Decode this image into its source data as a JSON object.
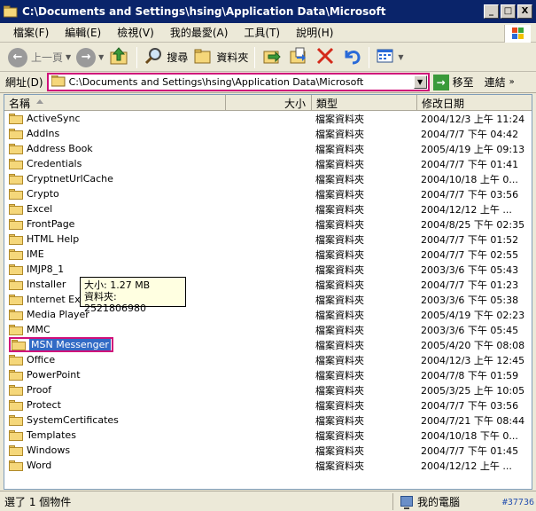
{
  "window": {
    "title": "C:\\Documents and Settings\\hsing\\Application Data\\Microsoft",
    "minimize": "_",
    "maximize": "□",
    "close": "X"
  },
  "menu": [
    "檔案(F)",
    "編輯(E)",
    "檢視(V)",
    "我的最愛(A)",
    "工具(T)",
    "說明(H)"
  ],
  "toolbar": {
    "back_label": "上一頁",
    "search_label": "搜尋",
    "folders_label": "資料夾"
  },
  "address": {
    "label": "網址(D)",
    "value": "C:\\Documents and Settings\\hsing\\Application Data\\Microsoft",
    "go_label": "移至",
    "links_label": "連結"
  },
  "columns": {
    "name": "名稱",
    "size": "大小",
    "type": "類型",
    "modified": "修改日期"
  },
  "items": [
    {
      "name": "ActiveSync",
      "type": "檔案資料夾",
      "date": "2004/12/3 上午 11:24"
    },
    {
      "name": "AddIns",
      "type": "檔案資料夾",
      "date": "2004/7/7 下午 04:42"
    },
    {
      "name": "Address Book",
      "type": "檔案資料夾",
      "date": "2005/4/19 上午 09:13"
    },
    {
      "name": "Credentials",
      "type": "檔案資料夾",
      "date": "2004/7/7 下午 01:41"
    },
    {
      "name": "CryptnetUrlCache",
      "type": "檔案資料夾",
      "date": "2004/10/18 上午 0..."
    },
    {
      "name": "Crypto",
      "type": "檔案資料夾",
      "date": "2004/7/7 下午 03:56"
    },
    {
      "name": "Excel",
      "type": "檔案資料夾",
      "date": "2004/12/12 上午 ..."
    },
    {
      "name": "FrontPage",
      "type": "檔案資料夾",
      "date": "2004/8/25 下午 02:35"
    },
    {
      "name": "HTML Help",
      "type": "檔案資料夾",
      "date": "2004/7/7 下午 01:52"
    },
    {
      "name": "IME",
      "type": "檔案資料夾",
      "date": "2004/7/7 下午 02:55"
    },
    {
      "name": "IMJP8_1",
      "type": "檔案資料夾",
      "date": "2003/3/6 下午 05:43"
    },
    {
      "name": "Installer",
      "type": "檔案資料夾",
      "date": "2004/7/7 下午 01:23"
    },
    {
      "name": "Internet Explorer",
      "type": "檔案資料夾",
      "date": "2003/3/6 下午 05:38"
    },
    {
      "name": "Media Player",
      "type": "檔案資料夾",
      "date": "2005/4/19 下午 02:23"
    },
    {
      "name": "MMC",
      "type": "檔案資料夾",
      "date": "2003/3/6 下午 05:45"
    },
    {
      "name": "MSN Messenger",
      "type": "檔案資料夾",
      "date": "2005/4/20 下午 08:08"
    },
    {
      "name": "Office",
      "type": "檔案資料夾",
      "date": "2004/12/3 上午 12:45"
    },
    {
      "name": "PowerPoint",
      "type": "檔案資料夾",
      "date": "2004/7/8 下午 01:59"
    },
    {
      "name": "Proof",
      "type": "檔案資料夾",
      "date": "2005/3/25 上午 10:05"
    },
    {
      "name": "Protect",
      "type": "檔案資料夾",
      "date": "2004/7/7 下午 03:56"
    },
    {
      "name": "SystemCertificates",
      "type": "檔案資料夾",
      "date": "2004/7/21 下午 08:44"
    },
    {
      "name": "Templates",
      "type": "檔案資料夾",
      "date": "2004/10/18 下午 0..."
    },
    {
      "name": "Windows",
      "type": "檔案資料夾",
      "date": "2004/7/7 下午 01:45"
    },
    {
      "name": "Word",
      "type": "檔案資料夾",
      "date": "2004/12/12 上午 ..."
    }
  ],
  "selected_item": "MSN Messenger",
  "tooltip": {
    "line1": "大小: 1.27 MB",
    "line2": "資料夾: 2521806980"
  },
  "status": {
    "left": "選了 1 個物件",
    "right": "我的電腦",
    "tag": "#37736"
  },
  "colors": {
    "titlebar": "#0a246a",
    "highlight_outline": "#d0107a",
    "selection": "#316ac5"
  }
}
